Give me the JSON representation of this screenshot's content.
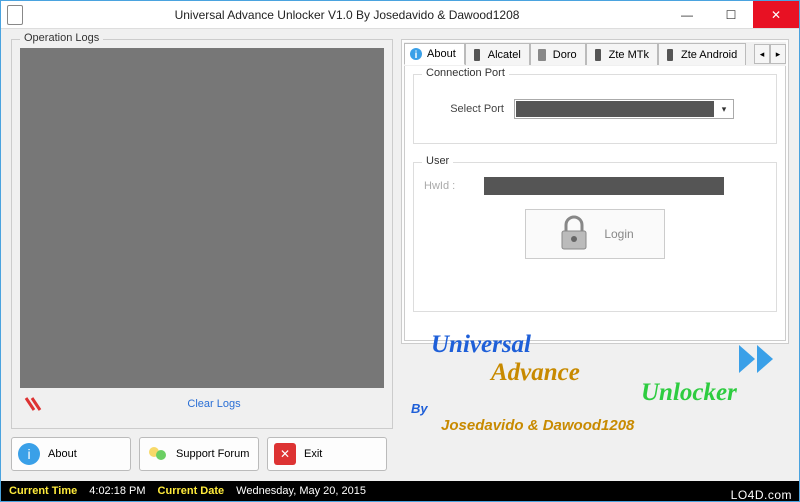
{
  "window": {
    "title": "Universal Advance Unlocker V1.0 By Josedavido & Dawood1208"
  },
  "logs": {
    "group_label": "Operation Logs",
    "clear_label": "Clear Logs"
  },
  "buttons": {
    "about": "About",
    "forum": "Support Forum",
    "exit": "Exit"
  },
  "tabs": {
    "about": "About",
    "alcatel": "Alcatel",
    "doro": "Doro",
    "ztemtk": "Zte MTk",
    "zteandroid": "Zte Android"
  },
  "connection": {
    "group_label": "Connection Port",
    "select_label": "Select Port"
  },
  "user": {
    "group_label": "User",
    "hwid_label": "HwId  :",
    "login_label": "Login"
  },
  "logo": {
    "l1": "Universal",
    "l2": "Advance",
    "l3": "Unlocker",
    "by": "By",
    "authors": "Josedavido & Dawood1208"
  },
  "status": {
    "time_label": "Current Time",
    "time_value": "4:02:18 PM",
    "date_label": "Current Date",
    "date_value": "Wednesday, May 20, 2015"
  },
  "watermark": "LO4D.com"
}
